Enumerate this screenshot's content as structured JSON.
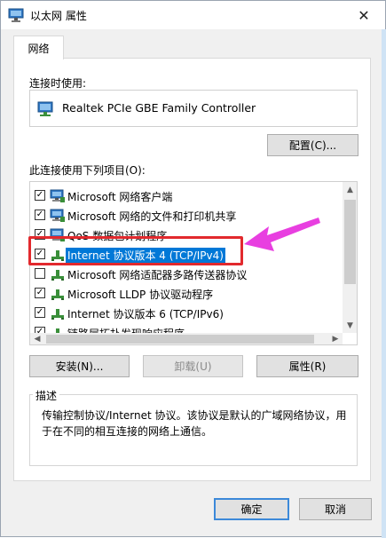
{
  "window": {
    "title": "以太网 属性",
    "close_symbol": "✕"
  },
  "tabs": [
    {
      "label": "网络"
    }
  ],
  "connect_using": {
    "label": "连接时使用:",
    "adapter_name": "Realtek PCIe GBE Family Controller",
    "configure_button": "配置(C)..."
  },
  "items_section": {
    "label": "此连接使用下列项目(O):",
    "items": [
      {
        "label": "Microsoft 网络客户端",
        "checked": true,
        "icon": "network-client-icon"
      },
      {
        "label": "Microsoft 网络的文件和打印机共享",
        "checked": true,
        "icon": "network-client-icon"
      },
      {
        "label": "QoS 数据包计划程序",
        "checked": true,
        "icon": "network-client-icon"
      },
      {
        "label": "Internet 协议版本 4 (TCP/IPv4)",
        "checked": true,
        "icon": "protocol-icon",
        "selected": true
      },
      {
        "label": "Microsoft 网络适配器多路传送器协议",
        "checked": false,
        "icon": "protocol-icon"
      },
      {
        "label": "Microsoft LLDP 协议驱动程序",
        "checked": true,
        "icon": "protocol-icon"
      },
      {
        "label": "Internet 协议版本 6 (TCP/IPv6)",
        "checked": true,
        "icon": "protocol-icon"
      },
      {
        "label": "链路层拓扑发现响应程序",
        "checked": true,
        "icon": "protocol-icon"
      }
    ],
    "check_mark": "✓"
  },
  "buttons": {
    "install": "安装(N)...",
    "uninstall": "卸载(U)",
    "properties": "属性(R)"
  },
  "description": {
    "title": "描述",
    "text": "传输控制协议/Internet 协议。该协议是默认的广域网络协议，用于在不同的相互连接的网络上通信。"
  },
  "footer": {
    "ok": "确定",
    "cancel": "取消"
  },
  "scroll_symbols": {
    "up": "▲",
    "down": "▼",
    "left": "◀",
    "right": "▶"
  },
  "colors": {
    "selection": "#0078d7",
    "highlight_box": "#e2292d",
    "arrow": "#e83fe0"
  }
}
